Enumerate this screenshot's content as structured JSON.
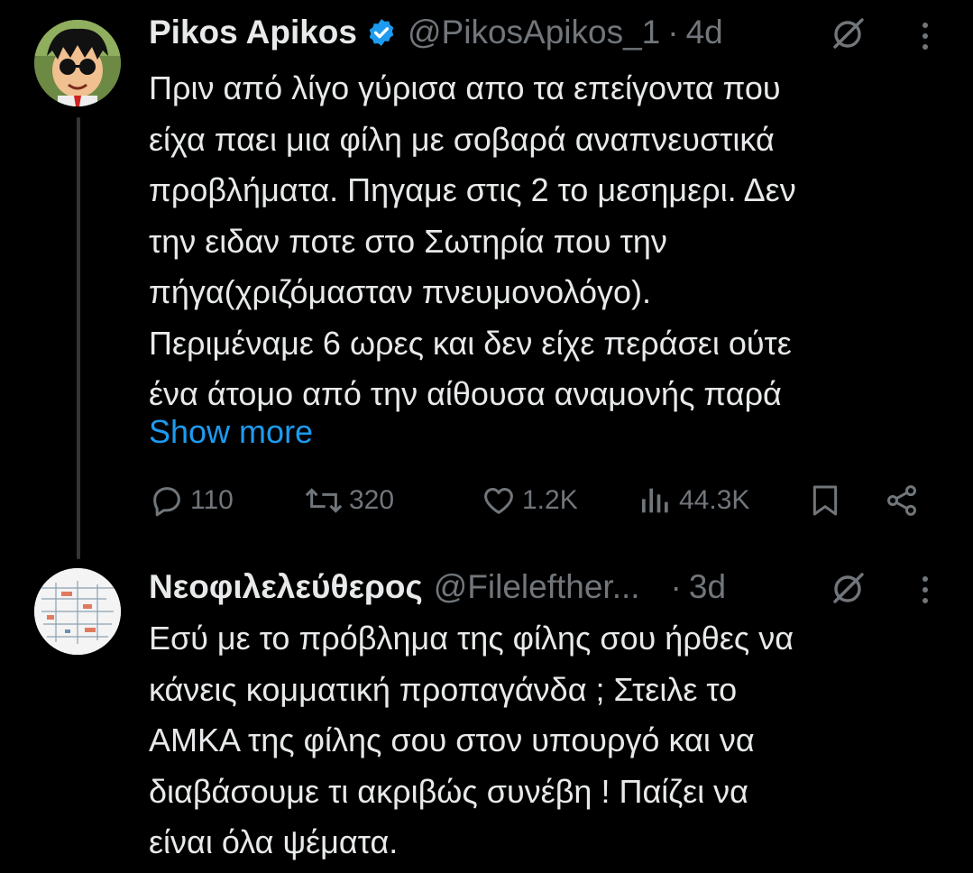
{
  "colors": {
    "background": "#000000",
    "text": "#e7e9ea",
    "secondary": "#71767b",
    "link": "#1d9bf0",
    "verified": "#1d9bf0"
  },
  "tweet1": {
    "name": "Pikos Apikos",
    "handle": "@PikosApikos_1",
    "separator": "·",
    "time": "4d",
    "verified": true,
    "lines": [
      "Πριν από λίγο  γύρισα απο τα επείγοντα που",
      "είχα παει μια φίλη με σοβαρά αναπνευστικά",
      "προβλήματα. Πηγαμε στις 2 το μεσημερι. Δεν",
      "την ειδαν ποτε στο Σωτηρία που την",
      "πήγα(χριζόμασταν πνευμονολόγο).",
      "Περιμέναμε 6 ωρες και δεν είχε περάσει ούτε",
      "ένα άτομο από την αίθουσα αναμονής παρά"
    ],
    "show_more": "Show more",
    "actions": {
      "replies": "110",
      "retweets": "320",
      "likes": "1.2K",
      "views": "44.3K"
    },
    "icons": [
      "reply-icon",
      "retweet-icon",
      "like-icon",
      "views-icon",
      "bookmark-icon",
      "share-icon",
      "grok-icon",
      "more-icon"
    ]
  },
  "tweet2": {
    "name": "Νεοφιλελεύθερος",
    "handle": "@Filelefther...",
    "separator": "·",
    "time": "3d",
    "lines": [
      "Εσύ με το πρόβλημα της φίλης σου ήρθες να",
      "κάνεις κομματική προπαγάνδα ; Στειλε το",
      "ΑΜΚΑ της φίλης σου στον υπουργό και να",
      "διαβάσουμε τι ακριβώς συνέβη ! Παίζει να",
      "είναι όλα ψέματα."
    ]
  }
}
